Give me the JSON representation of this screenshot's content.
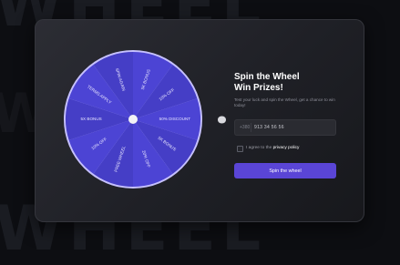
{
  "background": {
    "word": "WHEEL",
    "colors": {
      "page": "#0d0e12",
      "word": "#1a1c22"
    }
  },
  "wheel": {
    "segments": [
      "50% DISCOUNT",
      "5K BONUS",
      "20% OFF",
      "FREE WHEEL",
      "10% OFF",
      "5X BONUS",
      "TERMS APPLY",
      "SPIN AGAIN",
      "5K BONUS",
      "10% OFF"
    ],
    "colors": {
      "a": "#4c44d4",
      "b": "#453ec6",
      "rim": "#c6c1ff",
      "hub": "#f2f2f5",
      "text": "#e8e6ff"
    },
    "pointer_icon": "pointer-icon"
  },
  "panel": {
    "title_line1": "Spin the Wheel",
    "title_line2": "Win Prizes!",
    "description": "Test your luck and spin the Wheel, get a chance to win today!",
    "phone": {
      "country_code": "+380",
      "value": "913 34 56 56"
    },
    "consent": {
      "prefix": "I agree to the",
      "link": "privacy policy",
      "checked": false
    },
    "button_label": "Spin the wheel",
    "accent": "#5a45d6"
  }
}
